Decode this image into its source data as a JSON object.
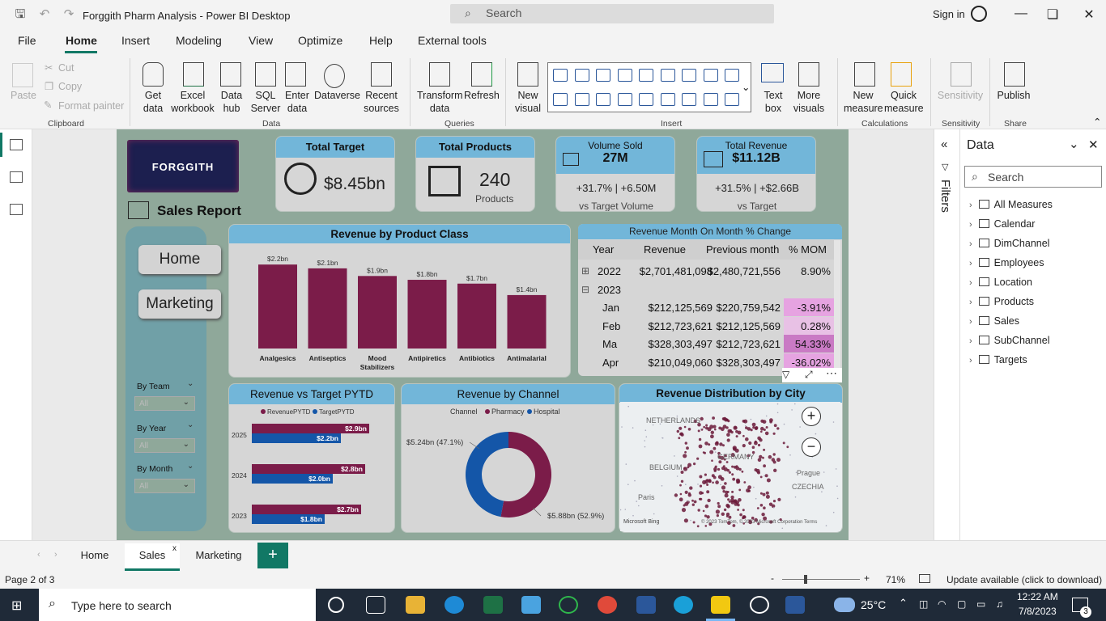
{
  "titlebar": {
    "title": "Forggith Pharm Analysis - Power BI Desktop",
    "search_placeholder": "Search",
    "signin": "Sign in"
  },
  "menu": [
    "File",
    "Home",
    "Insert",
    "Modeling",
    "View",
    "Optimize",
    "Help",
    "External tools"
  ],
  "ribbon": {
    "paste": "Paste",
    "cut": "Cut",
    "copy": "Copy",
    "format_painter": "Format painter",
    "get_data": "Get data",
    "excel": "Excel workbook",
    "datahub": "Data hub",
    "sql": "SQL Server",
    "enter": "Enter data",
    "dataverse": "Dataverse",
    "recent": "Recent sources",
    "transform": "Transform data",
    "refresh": "Refresh",
    "new_visual": "New visual",
    "text_box": "Text box",
    "more_visuals": "More visuals",
    "new_measure": "New measure",
    "quick_measure": "Quick measure",
    "sensitivity": "Sensitivity",
    "publish": "Publish",
    "groups": {
      "clipboard": "Clipboard",
      "data": "Data",
      "queries": "Queries",
      "insert": "Insert",
      "calculations": "Calculations",
      "sensitivity": "Sensitivity",
      "share": "Share"
    }
  },
  "report": {
    "logo": "FORGGITH",
    "title": "Sales Report",
    "kpis": {
      "target": {
        "label": "Total Target",
        "value": "$8.45bn"
      },
      "products": {
        "label": "Total Products",
        "value": "240",
        "sub": "Products"
      },
      "volume": {
        "label": "Volume Sold",
        "value": "27M",
        "delta": "+31.7% | +6.50M",
        "sub": "vs Target Volume"
      },
      "revenue": {
        "label": "Total Revenue",
        "value": "$11.12B",
        "delta": "+31.5% | +$2.66B",
        "sub": "vs Target"
      }
    },
    "nav": {
      "home": "Home",
      "marketing": "Marketing"
    },
    "slicers": [
      {
        "label": "By Team",
        "value": "All"
      },
      {
        "label": "By Year",
        "value": "All"
      },
      {
        "label": "By Month",
        "value": "All"
      }
    ],
    "bar_title": "Revenue by Product Class",
    "pytd_title": "Revenue vs Target PYTD",
    "channel_title": "Revenue by Channel",
    "map_title": "Revenue Distribution by City",
    "matrix": {
      "title": "Revenue Month On Month % Change",
      "headers": [
        "Year",
        "Revenue",
        "Previous month",
        "% MOM"
      ],
      "rows": [
        {
          "exp": "⊞",
          "label": "2022",
          "rev": "$2,701,481,098",
          "prev": "$2,480,721,556",
          "mom": "8.90%"
        },
        {
          "exp": "⊟",
          "label": "2023",
          "rev": "",
          "prev": "",
          "mom": ""
        },
        {
          "label": "Jan",
          "rev": "$212,125,569",
          "prev": "$220,759,542",
          "mom": "-3.91%"
        },
        {
          "label": "Feb",
          "rev": "$212,723,621",
          "prev": "$212,125,569",
          "mom": "0.28%"
        },
        {
          "label": "Ma",
          "rev": "$328,303,497",
          "prev": "$212,723,621",
          "mom": "54.33%"
        },
        {
          "label": "Apr",
          "rev": "$210,049,060",
          "prev": "$328,303,497",
          "mom": "-36.02%"
        }
      ]
    },
    "map_labels": {
      "netherlands": "NETHERLANDS",
      "belgium": "BELGIUM",
      "germany": "GERMANY",
      "czechia": "CZECHIA",
      "paris": "Paris",
      "prague": "Prague",
      "bing": "Microsoft Bing",
      "copyright": "© 2023 TomTom, © 2023 Microsoft Corporation  Terms"
    }
  },
  "chart_data": [
    {
      "type": "bar",
      "title": "Revenue by Product Class",
      "categories": [
        "Analgesics",
        "Antiseptics",
        "Mood Stabilizers",
        "Antipiretics",
        "Antibiotics",
        "Antimalarial"
      ],
      "values": [
        2.2,
        2.1,
        1.9,
        1.8,
        1.7,
        1.4
      ],
      "labels": [
        "$2.2bn",
        "$2.1bn",
        "$1.9bn",
        "$1.8bn",
        "$1.7bn",
        "$1.4bn"
      ],
      "color": "#7b1c49"
    },
    {
      "type": "bar",
      "title": "Revenue vs Target PYTD",
      "categories": [
        "2025",
        "2024",
        "2023"
      ],
      "series": [
        {
          "name": "RevenuePYTD",
          "values": [
            2.9,
            2.8,
            2.7
          ],
          "labels": [
            "$2.9bn",
            "$2.8bn",
            "$2.7bn"
          ],
          "color": "#7b1c49"
        },
        {
          "name": "TargetPYTD",
          "values": [
            2.2,
            2.0,
            1.8
          ],
          "labels": [
            "$2.2bn",
            "$2.0bn",
            "$1.8bn"
          ],
          "color": "#1456a8"
        }
      ]
    },
    {
      "type": "pie",
      "title": "Revenue by Channel",
      "legend_title": "Channel",
      "categories": [
        "Pharmacy",
        "Hospital"
      ],
      "values": [
        5.88,
        5.24
      ],
      "labels": [
        "$5.88bn (52.9%)",
        "$5.24bn (47.1%)"
      ],
      "colors": [
        "#7b1c49",
        "#1456a8"
      ]
    }
  ],
  "data_pane": {
    "title": "Data",
    "search": "Search",
    "tables": [
      "All Measures",
      "Calendar",
      "DimChannel",
      "Employees",
      "Location",
      "Products",
      "Sales",
      "SubChannel",
      "Targets"
    ]
  },
  "filters_label": "Filters",
  "pages": [
    "Home",
    "Sales",
    "Marketing"
  ],
  "status": {
    "page": "Page 2 of 3",
    "zoom": "71%",
    "update": "Update available (click to download)"
  },
  "taskbar": {
    "search": "Type here to search",
    "temp": "25°C",
    "time": "12:22 AM",
    "date": "7/8/2023",
    "notif": "3"
  }
}
